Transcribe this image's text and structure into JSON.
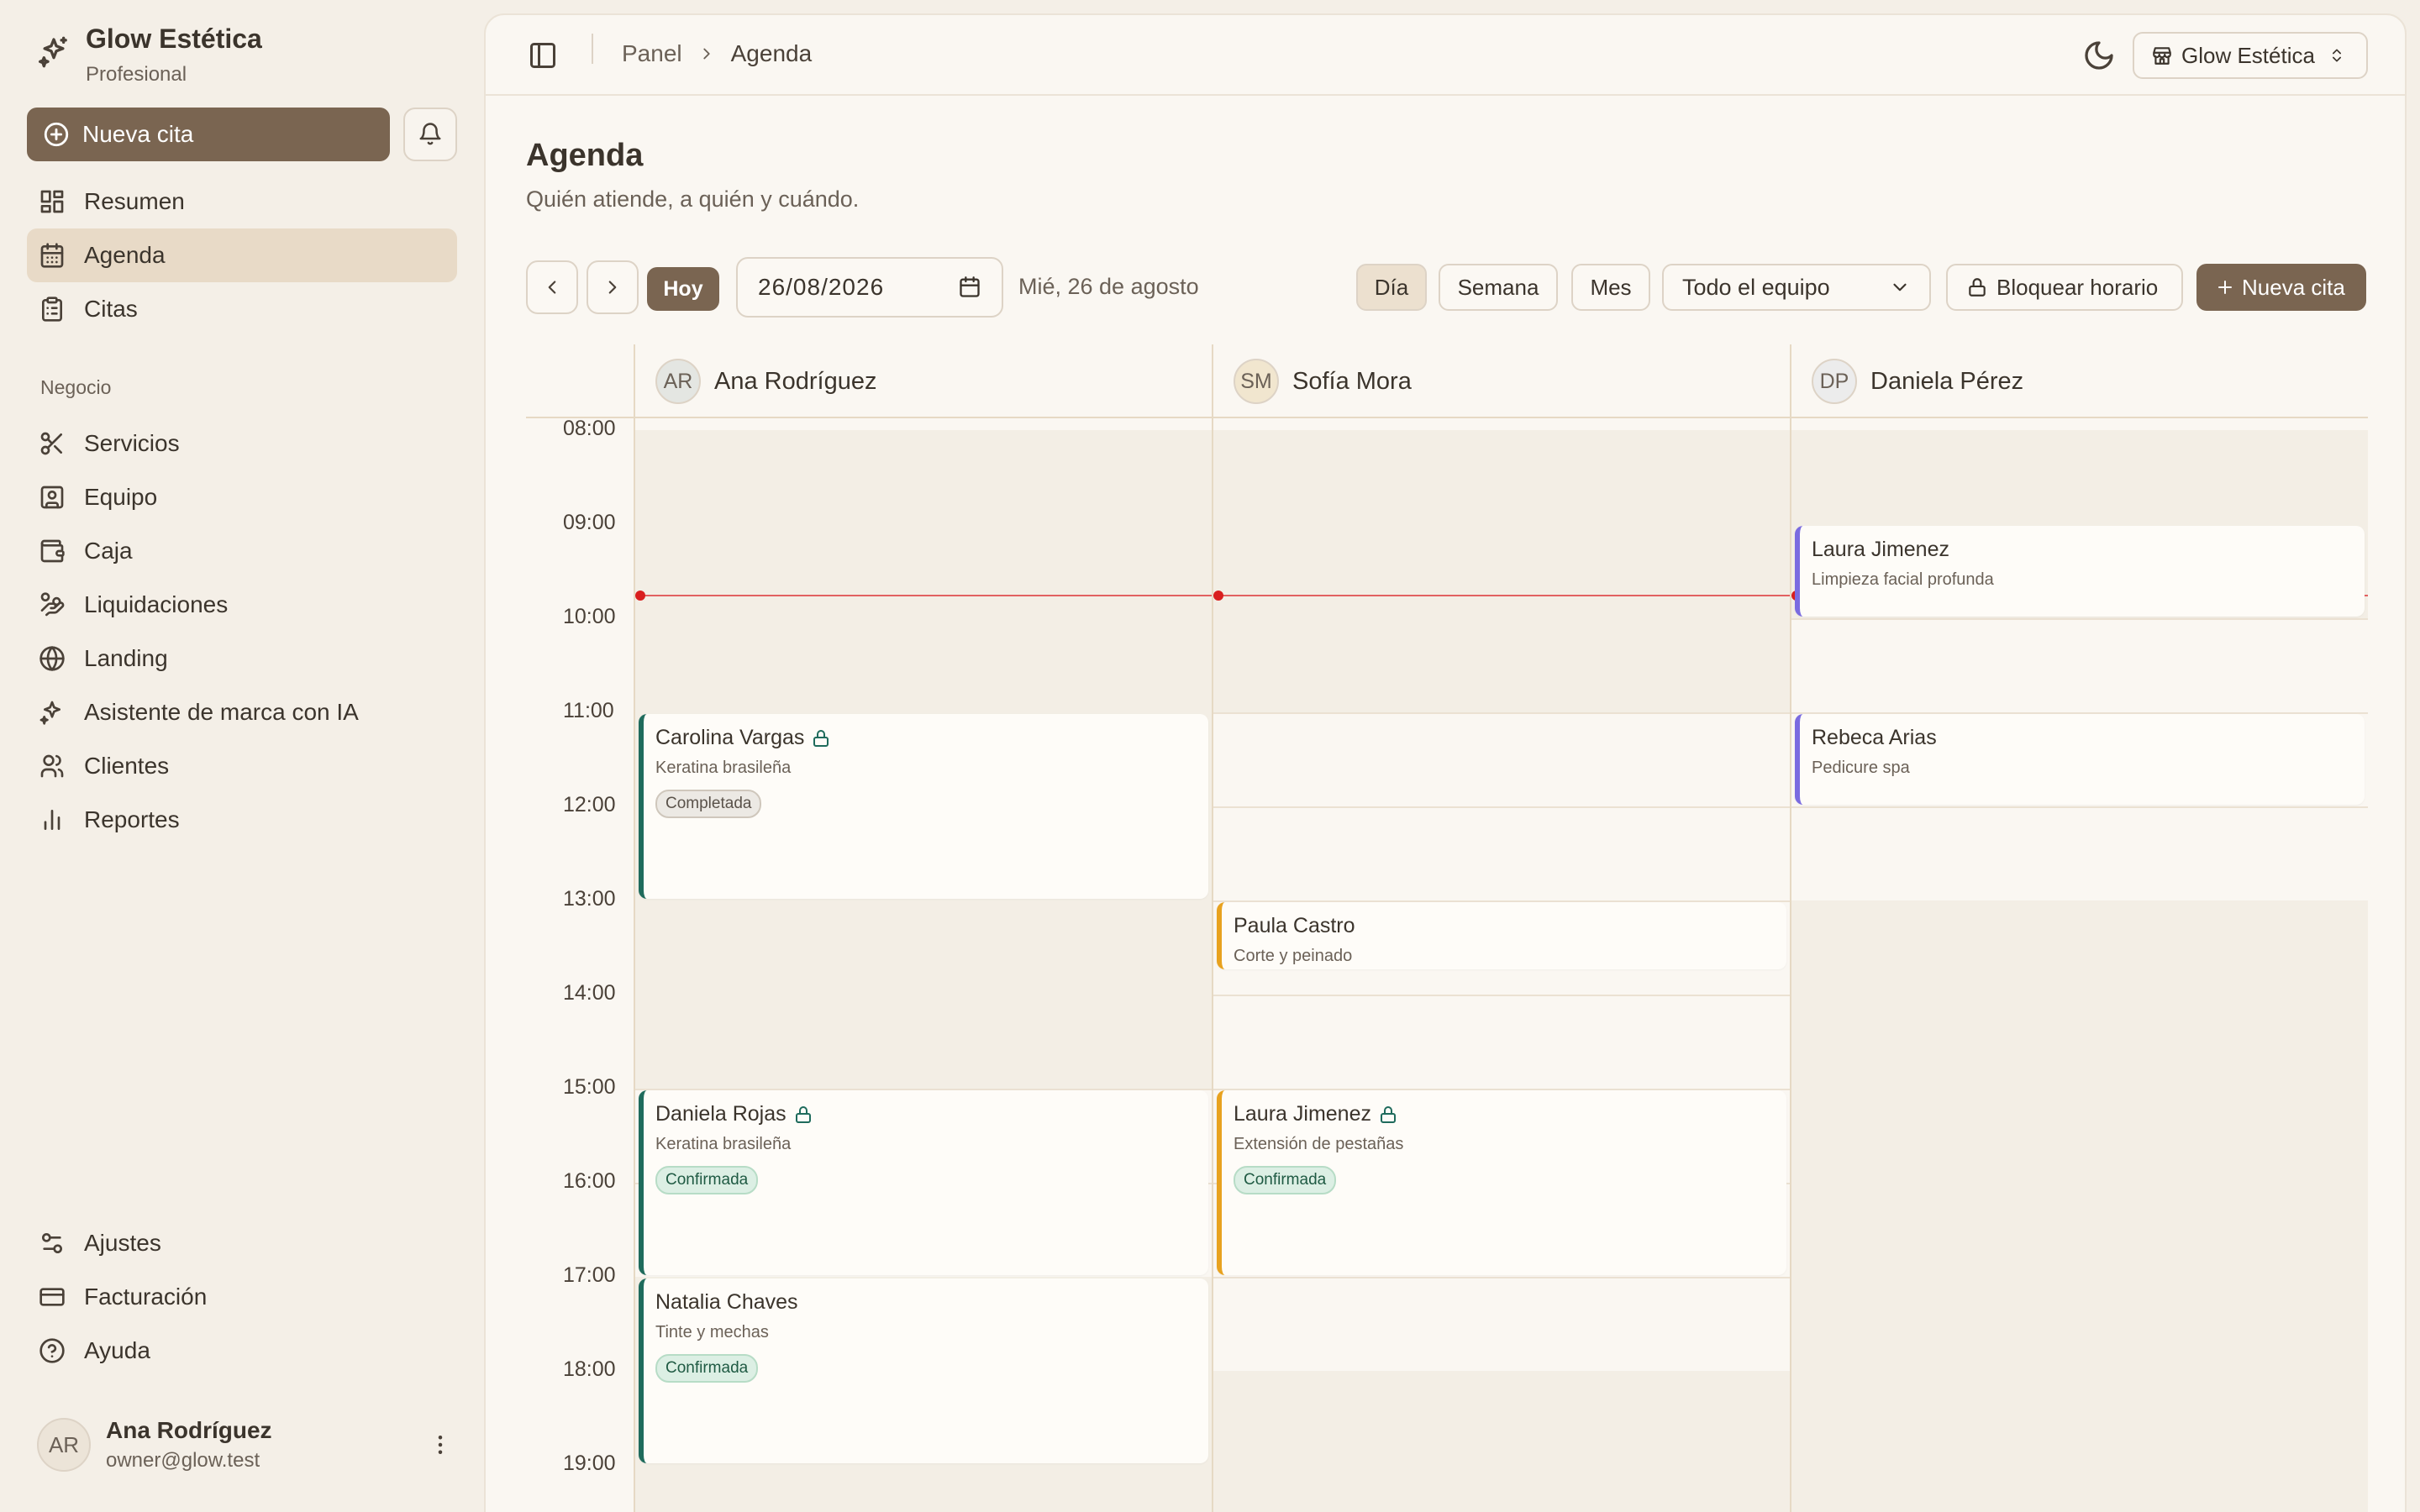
{
  "sidebar": {
    "brand_name": "Glow Estética",
    "brand_plan": "Profesional",
    "new_appointment": "Nueva cita",
    "nav": [
      {
        "label": "Resumen",
        "icon": "dashboard-icon"
      },
      {
        "label": "Agenda",
        "icon": "calendar-icon",
        "active": true
      },
      {
        "label": "Citas",
        "icon": "clipboard-icon"
      }
    ],
    "section_business": "Negocio",
    "business_nav": [
      {
        "label": "Servicios",
        "icon": "scissors-icon"
      },
      {
        "label": "Equipo",
        "icon": "user-square-icon"
      },
      {
        "label": "Caja",
        "icon": "wallet-icon"
      },
      {
        "label": "Liquidaciones",
        "icon": "hand-coins-icon"
      },
      {
        "label": "Landing",
        "icon": "globe-icon"
      },
      {
        "label": "Asistente de marca con IA",
        "icon": "sparkles-icon"
      },
      {
        "label": "Clientes",
        "icon": "users-icon"
      },
      {
        "label": "Reportes",
        "icon": "bar-chart-icon"
      }
    ],
    "bottom_nav": [
      {
        "label": "Ajustes",
        "icon": "sliders-icon"
      },
      {
        "label": "Facturación",
        "icon": "credit-card-icon"
      },
      {
        "label": "Ayuda",
        "icon": "help-circle-icon"
      }
    ],
    "user": {
      "initials": "AR",
      "name": "Ana Rodríguez",
      "email": "owner@glow.test"
    }
  },
  "topbar": {
    "breadcrumb": [
      "Panel",
      "Agenda"
    ],
    "store": "Glow Estética"
  },
  "page": {
    "title": "Agenda",
    "subtitle": "Quién atiende, a quién y cuándo."
  },
  "toolbar": {
    "today": "Hoy",
    "date_value": "26/08/2026",
    "date_label": "Mié, 26 de agosto",
    "views": [
      "Día",
      "Semana",
      "Mes"
    ],
    "active_view": "Día",
    "team_filter": "Todo el equipo",
    "block_label": "Bloquear horario",
    "new_label": "Nueva cita"
  },
  "calendar": {
    "hours": [
      "08:00",
      "09:00",
      "10:00",
      "11:00",
      "12:00",
      "13:00",
      "14:00",
      "15:00",
      "16:00",
      "17:00",
      "18:00",
      "19:00"
    ],
    "current_time": "09:45",
    "staff": [
      {
        "initials": "AR",
        "name": "Ana Rodríguez",
        "avatar_color": "#e4e6e2"
      },
      {
        "initials": "SM",
        "name": "Sofía Mora",
        "avatar_color": "#f1e6cf"
      },
      {
        "initials": "DP",
        "name": "Daniela Pérez",
        "avatar_color": "#ececec"
      }
    ],
    "appointments": [
      {
        "staff": 0,
        "start": "11:00",
        "end": "13:00",
        "client": "Carolina Vargas",
        "service": "Keratina brasileña",
        "status": "Completada",
        "locked": true,
        "color": "#1f6b5c"
      },
      {
        "staff": 0,
        "start": "15:00",
        "end": "17:00",
        "client": "Daniela Rojas",
        "service": "Keratina brasileña",
        "status": "Confirmada",
        "locked": true,
        "color": "#1f6b5c"
      },
      {
        "staff": 0,
        "start": "17:00",
        "end": "19:00",
        "client": "Natalia Chaves",
        "service": "Tinte y mechas",
        "status": "Confirmada",
        "locked": false,
        "color": "#1f6b5c"
      },
      {
        "staff": 1,
        "start": "13:00",
        "end": "13:45",
        "client": "Paula Castro",
        "service": "Corte y peinado",
        "status": "",
        "locked": false,
        "color": "#e8a21f"
      },
      {
        "staff": 1,
        "start": "15:00",
        "end": "17:00",
        "client": "Laura Jimenez",
        "service": "Extensión de pestañas",
        "status": "Confirmada",
        "locked": true,
        "color": "#e8a21f"
      },
      {
        "staff": 2,
        "start": "09:00",
        "end": "10:00",
        "client": "Laura Jimenez",
        "service": "Limpieza facial profunda",
        "status": "",
        "locked": false,
        "color": "#7a6be0"
      },
      {
        "staff": 2,
        "start": "11:00",
        "end": "12:00",
        "client": "Rebeca Arias",
        "service": "Pedicure spa",
        "status": "",
        "locked": false,
        "color": "#7a6be0"
      }
    ]
  }
}
